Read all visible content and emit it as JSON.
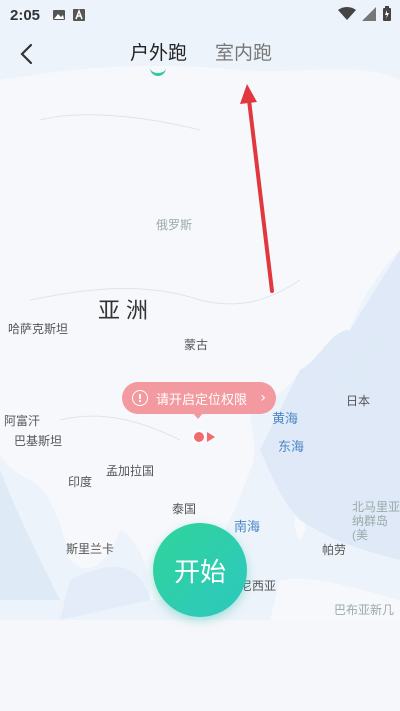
{
  "status_bar": {
    "time": "2:05"
  },
  "header": {
    "tabs": [
      {
        "label": "户外跑",
        "active": true
      },
      {
        "label": "室内跑",
        "active": false
      }
    ]
  },
  "map": {
    "labels": [
      {
        "text": "俄罗斯",
        "kind": "faint"
      },
      {
        "text": "亚洲",
        "kind": "big"
      },
      {
        "text": "哈萨克斯坦",
        "kind": "normal"
      },
      {
        "text": "蒙古",
        "kind": "normal"
      },
      {
        "text": "日本",
        "kind": "normal"
      },
      {
        "text": "阿富汗",
        "kind": "normal"
      },
      {
        "text": "巴基斯坦",
        "kind": "normal"
      },
      {
        "text": "黄海",
        "kind": "sea"
      },
      {
        "text": "东海",
        "kind": "sea"
      },
      {
        "text": "印度",
        "kind": "normal"
      },
      {
        "text": "孟加拉国",
        "kind": "normal"
      },
      {
        "text": "泰国",
        "kind": "normal"
      },
      {
        "text": "南海",
        "kind": "sea"
      },
      {
        "text": "北马里亚纳群岛(美",
        "kind": "faint"
      },
      {
        "text": "斯里兰卡",
        "kind": "normal"
      },
      {
        "text": "帕劳",
        "kind": "normal"
      },
      {
        "text": "尼西亚",
        "kind": "normal"
      },
      {
        "text": "巴布亚新几",
        "kind": "faint"
      }
    ]
  },
  "location_prompt": {
    "text": "请开启定位权限",
    "icon": "warning-icon"
  },
  "start_button": {
    "label": "开始"
  },
  "colors": {
    "accent": "#2ec8a8",
    "alert": "#f39aa0",
    "annotation_arrow": "#e0383e"
  }
}
